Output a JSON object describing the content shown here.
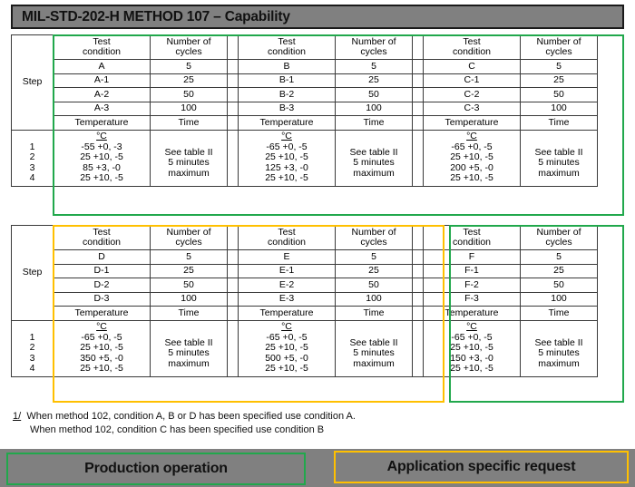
{
  "header": {
    "title": "MIL-STD-202-H METHOD 107 – Capability"
  },
  "labels": {
    "step": "Step",
    "test_condition_l1": "Test",
    "test_condition_l2": "condition",
    "number_of_cycles_l1": "Number of",
    "number_of_cycles_l2": "cycles",
    "temperature": "Temperature",
    "time": "Time",
    "degrees_c": "°C"
  },
  "colors": {
    "production_green": "#21a84c",
    "application_orange": "#ffc000",
    "title_bar_gray": "#808080",
    "grid_line": "#3a3a3a"
  },
  "tables": [
    {
      "id": "table-1",
      "steps": [
        "1",
        "2",
        "3",
        "4"
      ],
      "sections": [
        {
          "id": "section-a",
          "highlight": "green",
          "conditions": [
            "A",
            "A-1",
            "A-2",
            "A-3"
          ],
          "cycles": [
            "5",
            "25",
            "50",
            "100"
          ],
          "temperatures": [
            "-55 +0, -3",
            "25 +10, -5",
            "85 +3, -0",
            "25 +10, -5"
          ],
          "times": [
            "See table II",
            "5 minutes",
            "maximum"
          ]
        },
        {
          "id": "section-b",
          "highlight": "green",
          "conditions": [
            "B",
            "B-1",
            "B-2",
            "B-3"
          ],
          "cycles": [
            "5",
            "25",
            "50",
            "100"
          ],
          "temperatures": [
            "-65 +0, -5",
            "25 +10, -5",
            "125 +3, -0",
            "25 +10, -5"
          ],
          "times": [
            "See table II",
            "5 minutes",
            "maximum"
          ]
        },
        {
          "id": "section-c",
          "highlight": "green",
          "conditions": [
            "C",
            "C-1",
            "C-2",
            "C-3"
          ],
          "cycles": [
            "5",
            "25",
            "50",
            "100"
          ],
          "temperatures": [
            "-65 +0, -5",
            "25 +10, -5",
            "200 +5, -0",
            "25 +10, -5"
          ],
          "times": [
            "See table II",
            "5 minutes",
            "maximum"
          ]
        }
      ]
    },
    {
      "id": "table-2",
      "steps": [
        "1",
        "2",
        "3",
        "4"
      ],
      "sections": [
        {
          "id": "section-d",
          "highlight": "orange",
          "conditions": [
            "D",
            "D-1",
            "D-2",
            "D-3"
          ],
          "cycles": [
            "5",
            "25",
            "50",
            "100"
          ],
          "temperatures": [
            "-65 +0, -5",
            "25 +10, -5",
            "350 +5, -0",
            "25 +10, -5"
          ],
          "times": [
            "See table II",
            "5 minutes",
            "maximum"
          ]
        },
        {
          "id": "section-e",
          "highlight": "orange",
          "conditions": [
            "E",
            "E-1",
            "E-2",
            "E-3"
          ],
          "cycles": [
            "5",
            "25",
            "50",
            "100"
          ],
          "temperatures": [
            "-65 +0, -5",
            "25 +10, -5",
            "500 +5, -0",
            "25 +10, -5"
          ],
          "times": [
            "See table II",
            "5 minutes",
            "maximum"
          ]
        },
        {
          "id": "section-f",
          "highlight": "green",
          "conditions": [
            "F",
            "F-1",
            "F-2",
            "F-3"
          ],
          "cycles": [
            "5",
            "25",
            "50",
            "100"
          ],
          "temperatures": [
            "-65 +0, -5",
            "25 +10, -5",
            "150 +3, -0",
            "25 +10, -5"
          ],
          "times": [
            "See table II",
            "5 minutes",
            "maximum"
          ]
        }
      ]
    }
  ],
  "footnote": {
    "mark": "1/",
    "line1": "When method 102, condition A, B or D has been specified use condition A.",
    "line2": "When method 102, condition C has been specified use condition B"
  },
  "legend": {
    "production": "Production operation",
    "application": "Application specific request"
  }
}
